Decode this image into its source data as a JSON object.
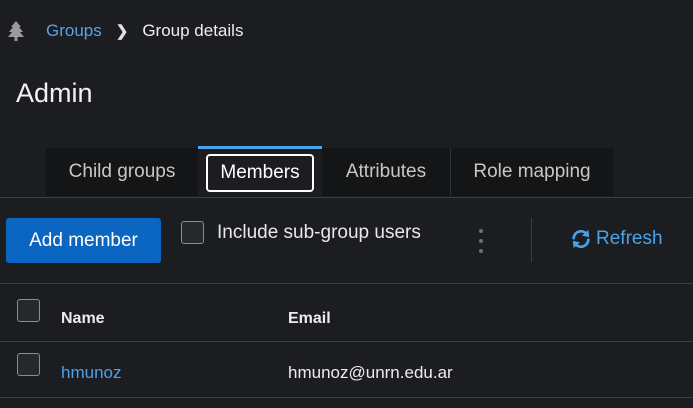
{
  "breadcrumb": {
    "icon": "tree-icon",
    "parent_label": "Groups",
    "current_label": "Group details"
  },
  "page": {
    "title": "Admin"
  },
  "tabs": [
    {
      "label": "Child groups",
      "active": false
    },
    {
      "label": "Members",
      "active": true
    },
    {
      "label": "Attributes",
      "active": false
    },
    {
      "label": "Role mapping",
      "active": false
    }
  ],
  "toolbar": {
    "add_member_label": "Add member",
    "include_subgroup_label": "Include sub-group users",
    "include_subgroup_checked": false,
    "kebab_icon": "kebab-icon",
    "refresh_label": "Refresh",
    "refresh_icon": "refresh-icon"
  },
  "table": {
    "columns": [
      "Name",
      "Email"
    ],
    "rows": [
      {
        "name": "hmunoz",
        "email": "hmunoz@unrn.edu.ar",
        "selected": false
      }
    ]
  },
  "colors": {
    "background": "#1b1d21",
    "accent": "#4aa3e8",
    "primary_button": "#0b66c2"
  }
}
